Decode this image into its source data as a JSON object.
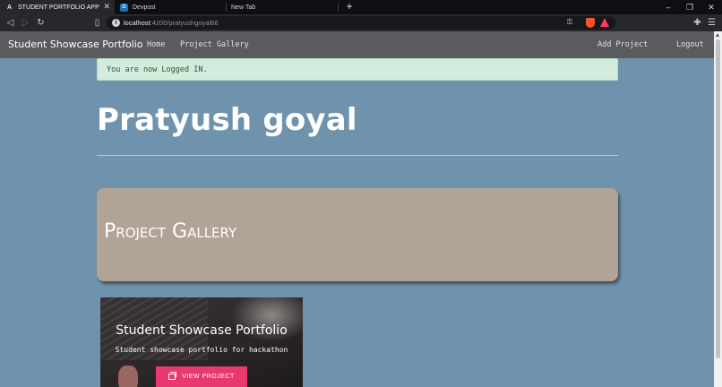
{
  "browser": {
    "tabs": [
      {
        "title": "STUDENT PORTFOLIO APP",
        "favicon": "A",
        "active": true
      },
      {
        "title": "Devpost",
        "favicon": "D",
        "active": false
      },
      {
        "title": "New Tab",
        "favicon": "",
        "active": false
      }
    ],
    "url_host": "localhost",
    "url_path": ":4200/pratyushgoyal66",
    "colors": {
      "tab_bar": "#0e0f13",
      "toolbar": "#26282d"
    }
  },
  "navbar": {
    "brand": "Student Showcase Portfolio",
    "links": {
      "home": "Home",
      "gallery": "Project Gallery",
      "add": "Add Project",
      "logout": "Logout"
    }
  },
  "alert": {
    "message": "You are now Logged IN."
  },
  "profile": {
    "name": "Pratyush goyal"
  },
  "gallery": {
    "title": "Project Gallery"
  },
  "projects": [
    {
      "title": "Student Showcase Portfolio",
      "description": "Student showcase portfolio for hackathon",
      "button": "VIEW PROJECT"
    }
  ],
  "colors": {
    "page_bg": "#6f93ad",
    "navbar_bg": "#5a5b5e",
    "alert_bg": "#d4ecdd",
    "jumbotron_bg": "#b1a395",
    "button_accent": "#e8386e"
  }
}
